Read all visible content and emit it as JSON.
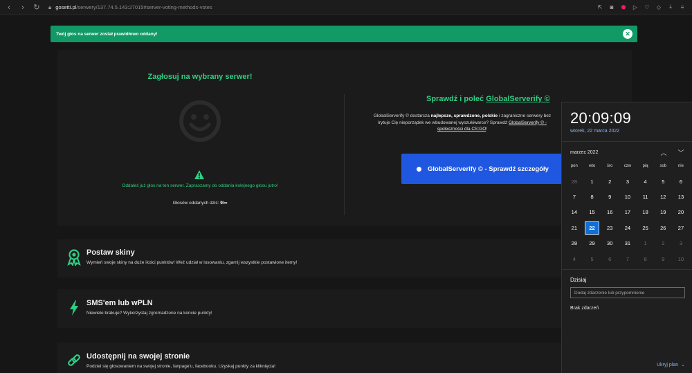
{
  "browser": {
    "url_domain": "gosetti.pl",
    "url_path": "/serwery/137.74.5.143:27015#server-voting-methods-votes"
  },
  "alert": {
    "message": "Twój głos na serwer został prawidłowo oddany!",
    "close_glyph": "✕",
    "color": "#119a66"
  },
  "vote": {
    "title": "Zagłosuj na wybrany serwer!",
    "voted_message": "Oddałeś już głos na ten serwer. Zapraszamy do oddania kolejnego głosu jutro!",
    "votes_today_label": "Głosów oddanych dziś:",
    "votes_today_value": "9/∞"
  },
  "globalserverify": {
    "title_prefix": "Sprawdź i poleć",
    "title_link": "GlobalServerify ©",
    "desc_1": "GlobalServerify © dostarcza",
    "desc_bold_1": "najlepsze, sprawdzone, polskie",
    "desc_2": "i zagraniczne serwery bez",
    "desc_3": "Irytuje Cię nieporządek we wbudowanej wyszukiwarce? Sprawdź",
    "desc_link_1": "GlobalServerify © -",
    "desc_link_2": "społeczności dla CS:GO",
    "desc_end": "!",
    "button_label": "GlobalServerify © - Sprawdź szczegóły",
    "button_color": "#1f57e0"
  },
  "cards": [
    {
      "title": "Postaw skiny",
      "desc": "Wymień swoje skiny na duże ilości punktów! Weź udział w losowaniu, zgarnij wszystkie postawione itemy!",
      "icon": "award-icon"
    },
    {
      "title": "SMS'em lub wPLN",
      "desc": "Niewiele brakuje? Wykorzystaj zgromadzone na koncie punkty!",
      "icon": "lightning-icon"
    },
    {
      "title": "Udostępnij na swojej stronie",
      "desc": "Podziel się głosowaniem na swojej stronie, fanpage'u, facebooku. Uzyskaj punkty za kliknięcia!",
      "icon": "link-icon"
    }
  ],
  "calendar": {
    "time": "20:09:09",
    "date_full": "wtorek, 22 marca 2022",
    "month_label": "marzec 2022",
    "weekdays": [
      "pon",
      "wto",
      "śro",
      "czw",
      "pią",
      "sob",
      "nie"
    ],
    "days": [
      {
        "d": "28",
        "m": true
      },
      {
        "d": "1"
      },
      {
        "d": "2"
      },
      {
        "d": "3"
      },
      {
        "d": "4"
      },
      {
        "d": "5"
      },
      {
        "d": "6"
      },
      {
        "d": "7"
      },
      {
        "d": "8"
      },
      {
        "d": "9"
      },
      {
        "d": "10"
      },
      {
        "d": "11"
      },
      {
        "d": "12"
      },
      {
        "d": "13"
      },
      {
        "d": "14"
      },
      {
        "d": "15"
      },
      {
        "d": "16"
      },
      {
        "d": "17"
      },
      {
        "d": "18"
      },
      {
        "d": "19"
      },
      {
        "d": "20"
      },
      {
        "d": "21"
      },
      {
        "d": "22",
        "today": true
      },
      {
        "d": "23"
      },
      {
        "d": "24"
      },
      {
        "d": "25"
      },
      {
        "d": "26"
      },
      {
        "d": "27"
      },
      {
        "d": "28"
      },
      {
        "d": "29"
      },
      {
        "d": "30"
      },
      {
        "d": "31"
      },
      {
        "d": "1",
        "m": true
      },
      {
        "d": "2",
        "m": true
      },
      {
        "d": "3",
        "m": true
      },
      {
        "d": "4",
        "m": true
      },
      {
        "d": "5",
        "m": true
      },
      {
        "d": "6",
        "m": true
      },
      {
        "d": "7",
        "m": true
      },
      {
        "d": "8",
        "m": true
      },
      {
        "d": "9",
        "m": true
      },
      {
        "d": "10",
        "m": true
      }
    ],
    "today_label": "Dzisiaj",
    "event_placeholder": "Dodaj zdarzenie lub przypomnienie",
    "no_events": "Brak zdarzeń",
    "hide_plan": "Ukryj plan",
    "accent": "#0f6ed8"
  }
}
